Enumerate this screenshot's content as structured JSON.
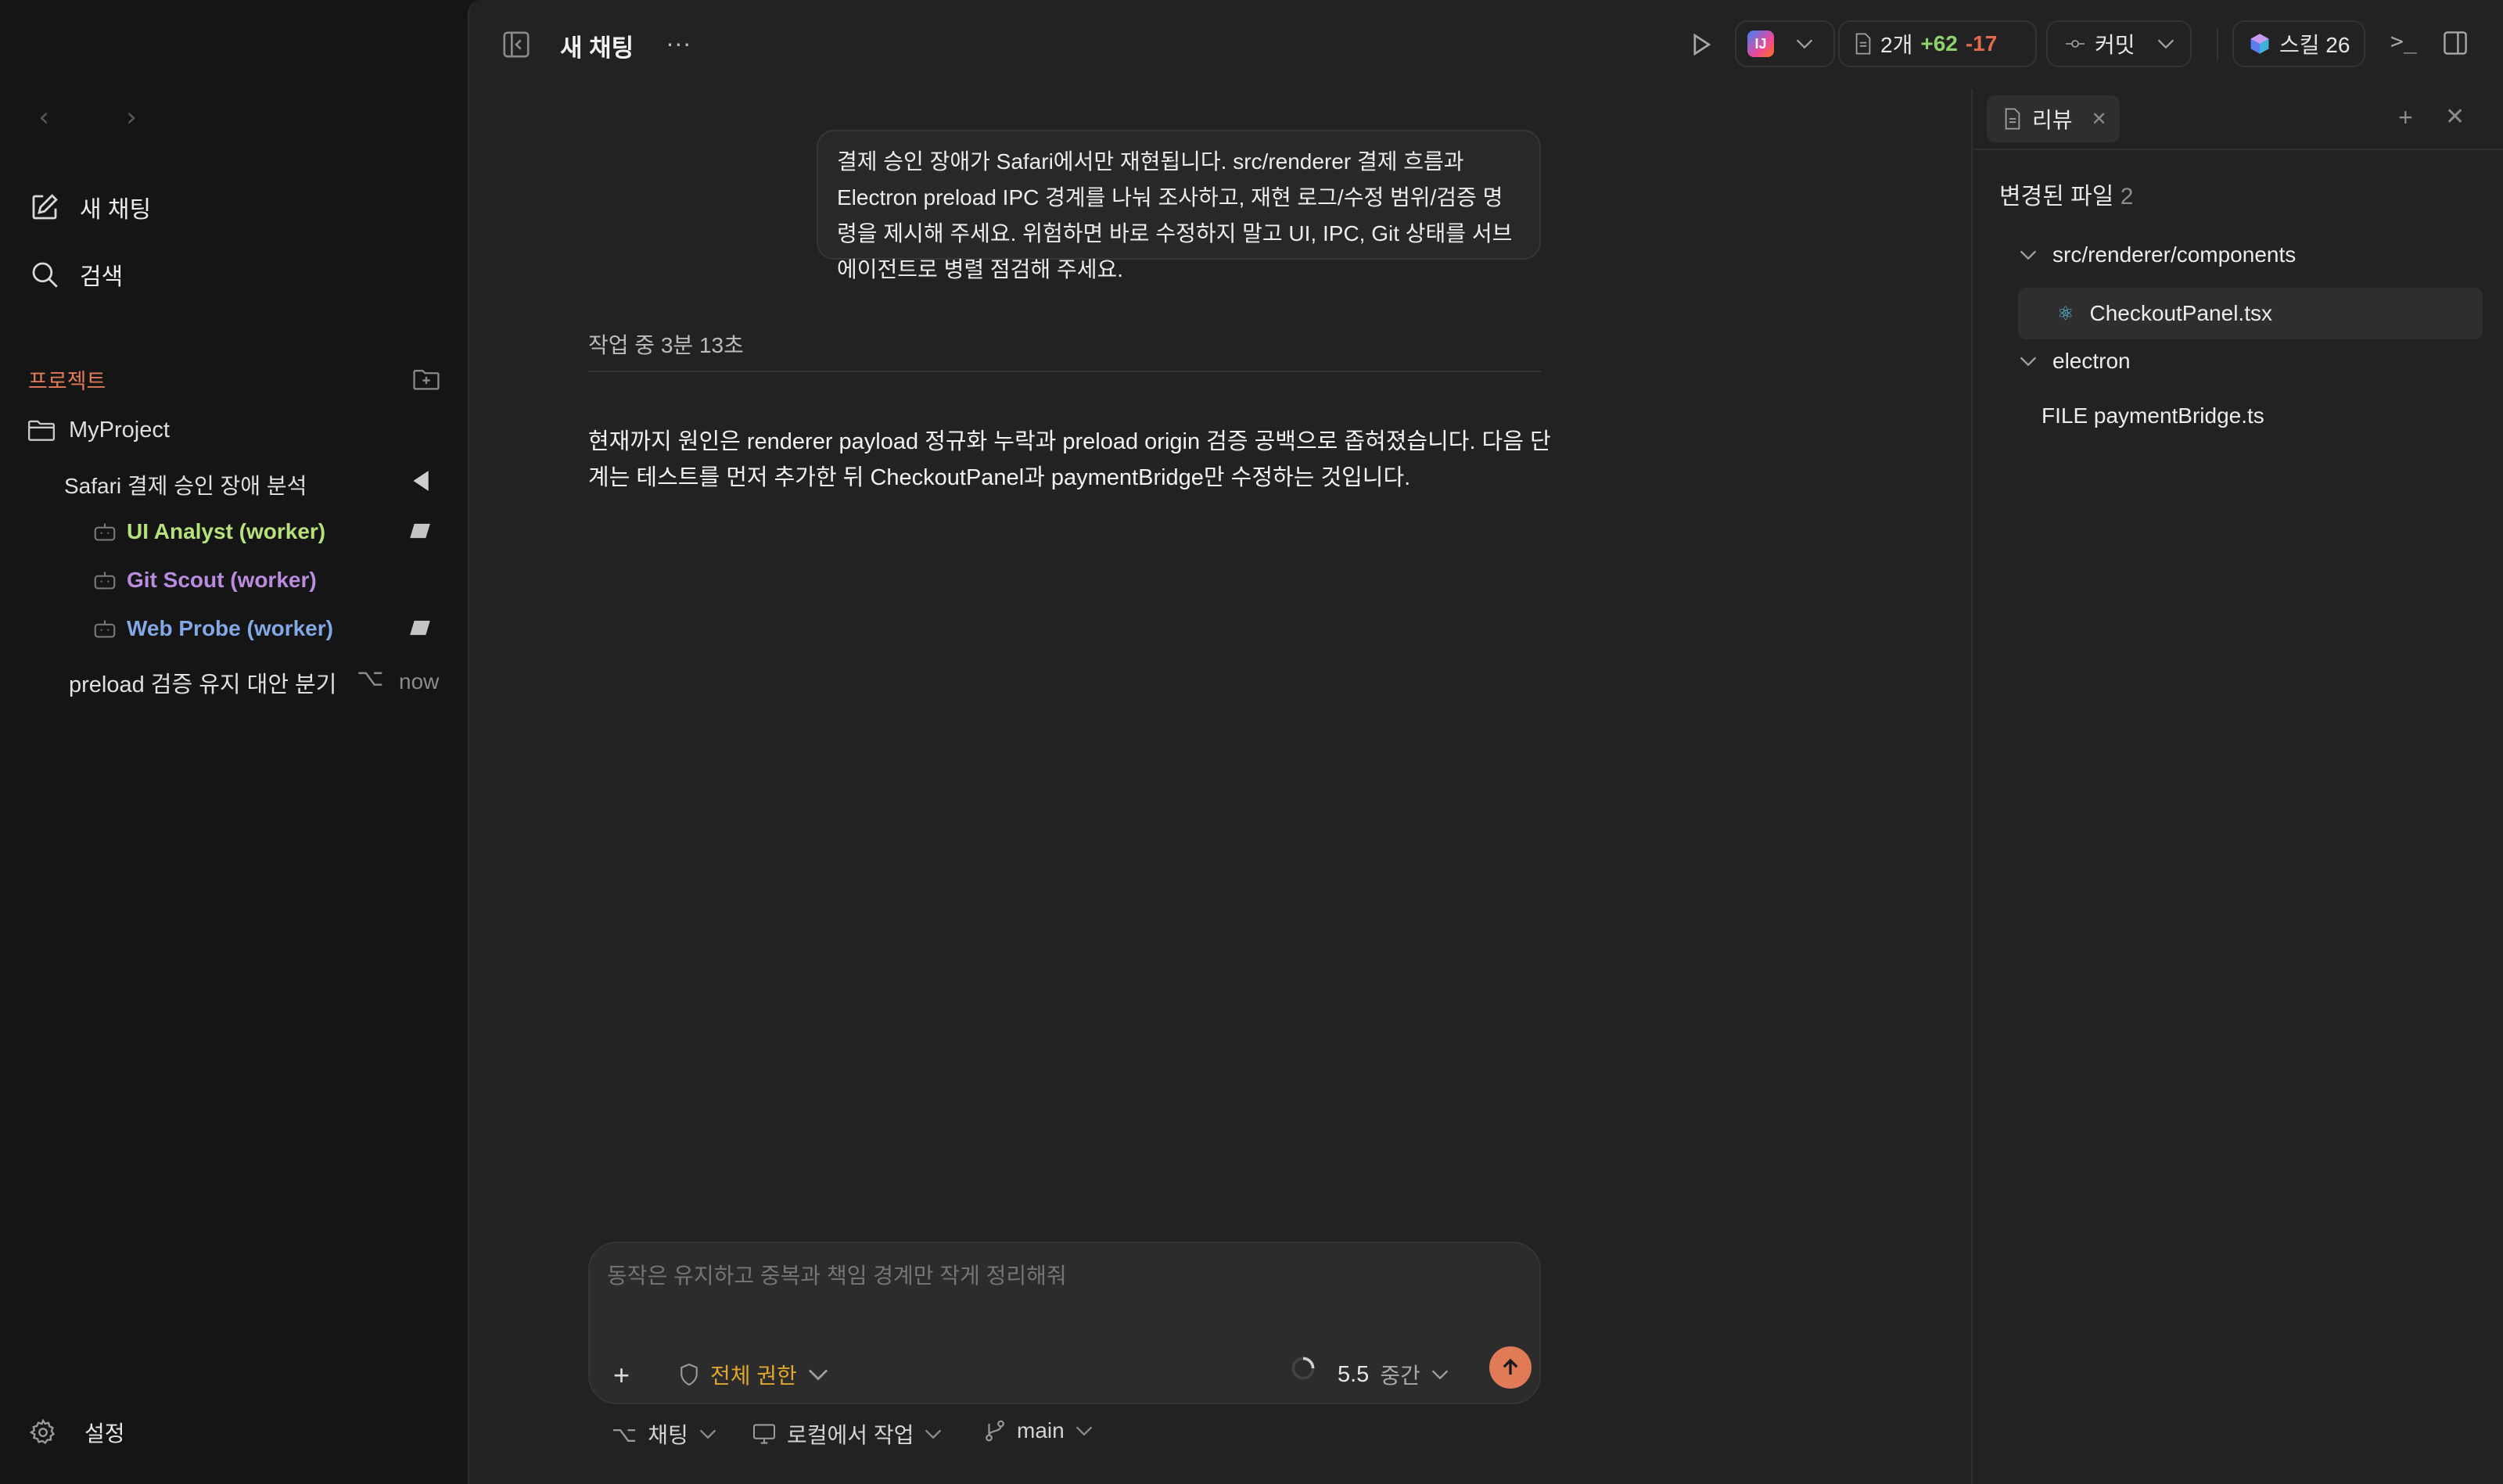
{
  "sidebar": {
    "nav_back": "‹",
    "nav_forward": "›",
    "new_chat_label": "새 채팅",
    "search_label": "검색",
    "projects_label": "프로젝트",
    "project_name": "MyProject",
    "thread_title": "Safari 결제 승인 장애 분석",
    "workers": [
      {
        "label": "UI Analyst (worker)",
        "color": "#b5e27a"
      },
      {
        "label": "Git Scout (worker)",
        "color": "#b98ce0"
      },
      {
        "label": "Web Probe (worker)",
        "color": "#82a8e6"
      }
    ],
    "branch_thread_title": "preload 검증 유지 대안 분기",
    "branch_thread_time": "now",
    "settings_label": "설정"
  },
  "header": {
    "title": "새 채팅",
    "more": "...",
    "ide_badge": "IJ",
    "diff_files": "2개",
    "diff_added": "+62",
    "diff_removed": "-17",
    "commit_label": "커밋",
    "skills_label": "스킬 26",
    "terminal_glyph": ">_"
  },
  "conversation": {
    "user_message": "결제 승인 장애가 Safari에서만 재현됩니다. src/renderer 결제 흐름과 Electron preload IPC 경계를 나눠 조사하고, 재현 로그/수정 범위/검증 명령을 제시해 주세요. 위험하면 바로 수정하지 말고 UI, IPC, Git 상태를 서브에이전트로 병렬 점검해 주세요.",
    "working_status": "작업 중 3분 13초",
    "assistant_message": "현재까지 원인은 renderer payload 정규화 누락과 preload origin 검증 공백으로 좁혀졌습니다. 다음 단계는 테스트를 먼저 추가한 뒤 CheckoutPanel과 paymentBridge만 수정하는 것입니다."
  },
  "composer": {
    "placeholder": "동작은 유지하고 중복과 책임 경계만 작게 정리해줘",
    "plus": "+",
    "permission_label": "전체 권한",
    "model_version": "5.5",
    "model_level": "중간"
  },
  "footer": {
    "mode_label": "채팅",
    "location_label": "로컬에서 작업",
    "branch_label": "main"
  },
  "review": {
    "tab_label": "리뷰",
    "changed_files_label": "변경된 파일",
    "changed_files_count": "2",
    "tree": {
      "folder1": "src/renderer/components",
      "file1": "CheckoutPanel.tsx",
      "folder2": "electron",
      "file2": "FILE paymentBridge.ts"
    }
  },
  "colors": {
    "accent": "#e07a57",
    "permission": "#e0a62d",
    "added": "#8fd16a",
    "removed": "#e5694f"
  }
}
